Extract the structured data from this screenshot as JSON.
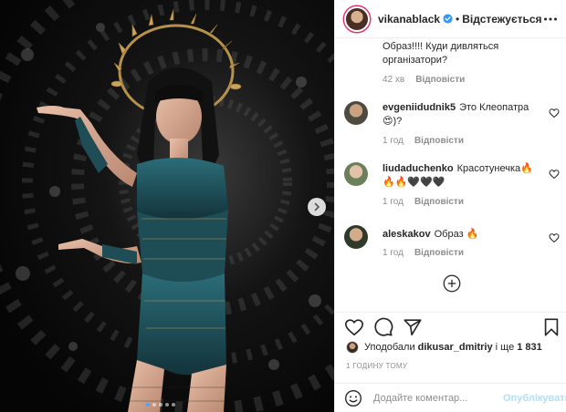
{
  "post": {
    "carousel": {
      "slide_count": 5,
      "active_slide": 1
    }
  },
  "header": {
    "username": "vikanablack",
    "separator": "•",
    "follow_label": "Відстежується"
  },
  "comments": [
    {
      "username": "",
      "text": "Образ!!!! Куди дивляться організатори?",
      "time": "42 хв",
      "reply": "Відповісти"
    },
    {
      "username": "evgeniidudnik5",
      "text": "Это Клеопатра 😍)?",
      "time": "1 год",
      "reply": "Відповісти"
    },
    {
      "username": "liudaduchenko",
      "text": "Красотунечка🔥🔥🔥🖤🖤🖤",
      "time": "1 год",
      "reply": "Відповісти"
    },
    {
      "username": "aleskakov",
      "text": "Образ 🔥",
      "time": "1 год",
      "reply": "Відповісти"
    }
  ],
  "likes": {
    "prefix": "Уподобали",
    "user": "dikusar_dmitriy",
    "middle": "і ще",
    "count": "1 831"
  },
  "timestamp": "1 годину тому",
  "composer": {
    "placeholder": "Додайте коментар...",
    "publish_label": "Опублікувати"
  },
  "icons": {
    "verified": "verified-badge-icon",
    "more": "more-options-icon",
    "like": "heart-icon",
    "comment": "comment-icon",
    "share": "share-icon",
    "save": "bookmark-icon",
    "emoji": "emoji-icon",
    "load_more": "plus-circle-icon",
    "carousel_next": "chevron-right-icon"
  },
  "colors": {
    "verified": "#3897f0",
    "link_disabled": "#b2dffc",
    "muted": "#8e8e8e",
    "text": "#262626"
  }
}
